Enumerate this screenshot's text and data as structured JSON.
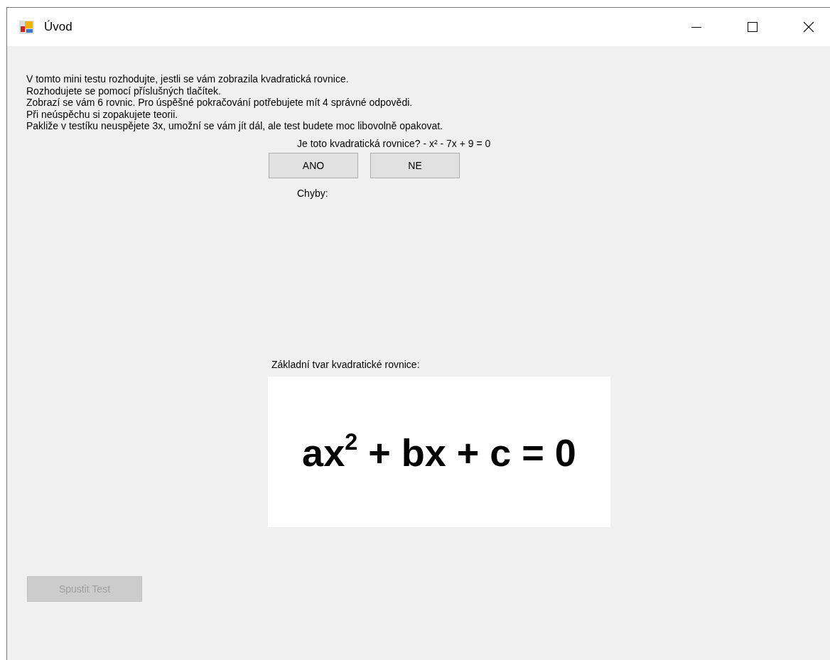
{
  "window": {
    "title": "Úvod"
  },
  "instructions": [
    "V tomto mini testu rozhodujte, jestli se vám zobrazila kvadratická rovnice.",
    "Rozhodujete se pomocí příslušných tlačítek.",
    "Zobrazí se vám 6 rovnic. Pro úspěšné pokračování potřebujete mít 4 správné odpovědi.",
    "Při neúspěchu si zopakujete teorii.",
    "Pakliže v testíku neuspějete 3x, umožní se vám jít dál, ale test budete moc libovolně opakovat."
  ],
  "question": "Je toto kvadratická rovnice?  - x² - 7x + 9 = 0",
  "answer_buttons": [
    {
      "label": "ANO"
    },
    {
      "label": "NE"
    }
  ],
  "errors_label": "Chyby:",
  "formula_caption": "Základní tvar kvadratické rovnice:",
  "formula": "ax$^{2}$ + bx + c = 0",
  "start_button": {
    "label": "Spustit Test",
    "disabled": true
  }
}
